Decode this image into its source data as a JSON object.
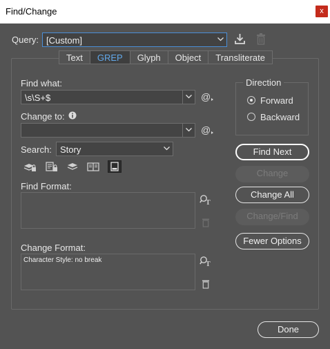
{
  "window": {
    "title": "Find/Change",
    "close_glyph": "x"
  },
  "query": {
    "label": "Query:",
    "value": "[Custom]"
  },
  "tabs": [
    {
      "label": "Text",
      "active": false
    },
    {
      "label": "GREP",
      "active": true
    },
    {
      "label": "Glyph",
      "active": false
    },
    {
      "label": "Object",
      "active": false
    },
    {
      "label": "Transliterate",
      "active": false
    }
  ],
  "find_what": {
    "label": "Find what:",
    "value": "\\s\\S+$"
  },
  "change_to": {
    "label": "Change to:",
    "value": ""
  },
  "search": {
    "label": "Search:",
    "value": "Story"
  },
  "find_format": {
    "label": "Find Format:",
    "value": ""
  },
  "change_format": {
    "label": "Change Format:",
    "value": "Character Style: no break"
  },
  "direction": {
    "label": "Direction",
    "forward": "Forward",
    "backward": "Backward",
    "selected": "Forward"
  },
  "buttons": {
    "find_next": "Find Next",
    "change": "Change",
    "change_all": "Change All",
    "change_find": "Change/Find",
    "fewer_options": "Fewer Options",
    "done": "Done"
  },
  "colors": {
    "accent": "#62a8ea",
    "background": "#535353",
    "close": "#c42b1c"
  }
}
